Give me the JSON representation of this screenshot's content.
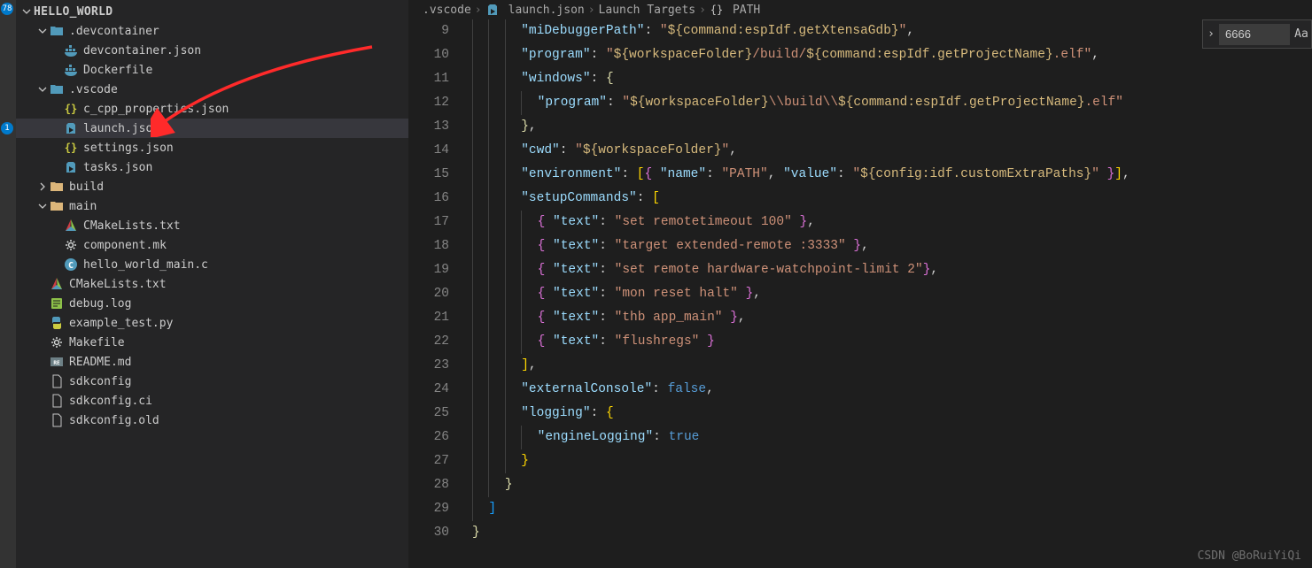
{
  "sidebar": {
    "rootName": "HELLO_WORLD",
    "tree": [
      {
        "indent": 1,
        "chev": "down",
        "icon": "folder-teal",
        "label": ".devcontainer"
      },
      {
        "indent": 2,
        "chev": "",
        "icon": "docker",
        "label": "devcontainer.json"
      },
      {
        "indent": 2,
        "chev": "",
        "icon": "docker",
        "label": "Dockerfile"
      },
      {
        "indent": 1,
        "chev": "down",
        "icon": "folder-teal",
        "label": ".vscode"
      },
      {
        "indent": 2,
        "chev": "",
        "icon": "json",
        "label": "c_cpp_properties.json"
      },
      {
        "indent": 2,
        "chev": "",
        "icon": "debug",
        "label": "launch.json",
        "selected": true
      },
      {
        "indent": 2,
        "chev": "",
        "icon": "json",
        "label": "settings.json"
      },
      {
        "indent": 2,
        "chev": "",
        "icon": "debug",
        "label": "tasks.json"
      },
      {
        "indent": 1,
        "chev": "right",
        "icon": "folder",
        "label": "build"
      },
      {
        "indent": 1,
        "chev": "down",
        "icon": "folder",
        "label": "main"
      },
      {
        "indent": 2,
        "chev": "",
        "icon": "cmake",
        "label": "CMakeLists.txt"
      },
      {
        "indent": 2,
        "chev": "",
        "icon": "gear",
        "label": "component.mk"
      },
      {
        "indent": 2,
        "chev": "",
        "icon": "c",
        "label": "hello_world_main.c"
      },
      {
        "indent": 1,
        "chev": "",
        "icon": "cmake",
        "label": "CMakeLists.txt"
      },
      {
        "indent": 1,
        "chev": "",
        "icon": "log",
        "label": "debug.log"
      },
      {
        "indent": 1,
        "chev": "",
        "icon": "python",
        "label": "example_test.py"
      },
      {
        "indent": 1,
        "chev": "",
        "icon": "gear",
        "label": "Makefile"
      },
      {
        "indent": 1,
        "chev": "",
        "icon": "readme",
        "label": "README.md"
      },
      {
        "indent": 1,
        "chev": "",
        "icon": "file",
        "label": "sdkconfig"
      },
      {
        "indent": 1,
        "chev": "",
        "icon": "file",
        "label": "sdkconfig.ci"
      },
      {
        "indent": 1,
        "chev": "",
        "icon": "file",
        "label": "sdkconfig.old"
      }
    ]
  },
  "breadcrumbs": {
    "parts": [
      {
        "icon": "",
        "text": ".vscode"
      },
      {
        "icon": "debug",
        "text": "launch.json"
      },
      {
        "icon": "",
        "text": "Launch Targets"
      },
      {
        "icon": "braces",
        "text": "PATH"
      }
    ]
  },
  "find": {
    "value": "6666"
  },
  "code": {
    "startLine": 9,
    "lines": [
      {
        "indent": 3,
        "tokens": [
          [
            "key",
            "\"miDebuggerPath\""
          ],
          [
            "punct",
            ": "
          ],
          [
            "str",
            "\""
          ],
          [
            "strvar",
            "${command:espIdf.getXtensaGdb}"
          ],
          [
            "str",
            "\""
          ],
          [
            "punct",
            ","
          ]
        ]
      },
      {
        "indent": 3,
        "tokens": [
          [
            "key",
            "\"program\""
          ],
          [
            "punct",
            ": "
          ],
          [
            "str",
            "\""
          ],
          [
            "strvar",
            "${workspaceFolder}"
          ],
          [
            "str",
            "/build/"
          ],
          [
            "strvar",
            "${command:espIdf.getProjectName}"
          ],
          [
            "str",
            ".elf\""
          ],
          [
            "punct",
            ","
          ]
        ]
      },
      {
        "indent": 3,
        "tokens": [
          [
            "key",
            "\"windows\""
          ],
          [
            "punct",
            ": "
          ],
          [
            "brace",
            "{"
          ]
        ]
      },
      {
        "indent": 4,
        "tokens": [
          [
            "key",
            "\"program\""
          ],
          [
            "punct",
            ": "
          ],
          [
            "str",
            "\""
          ],
          [
            "strvar",
            "${workspaceFolder}"
          ],
          [
            "str",
            "\\\\build\\\\"
          ],
          [
            "strvar",
            "${command:espIdf.getProjectName}"
          ],
          [
            "str",
            ".elf\""
          ]
        ]
      },
      {
        "indent": 3,
        "tokens": [
          [
            "brace",
            "}"
          ],
          [
            "punct",
            ","
          ]
        ]
      },
      {
        "indent": 3,
        "tokens": [
          [
            "key",
            "\"cwd\""
          ],
          [
            "punct",
            ": "
          ],
          [
            "str",
            "\""
          ],
          [
            "strvar",
            "${workspaceFolder}"
          ],
          [
            "str",
            "\""
          ],
          [
            "punct",
            ","
          ]
        ]
      },
      {
        "indent": 3,
        "tokens": [
          [
            "key",
            "\"environment\""
          ],
          [
            "punct",
            ": "
          ],
          [
            "bracket1",
            "["
          ],
          [
            "bracket2",
            "{"
          ],
          [
            "punct",
            " "
          ],
          [
            "key",
            "\"name\""
          ],
          [
            "punct",
            ": "
          ],
          [
            "str",
            "\"PATH\""
          ],
          [
            "punct",
            ", "
          ],
          [
            "key",
            "\"value\""
          ],
          [
            "punct",
            ": "
          ],
          [
            "str",
            "\""
          ],
          [
            "strvar",
            "${config:idf.customExtraPaths}"
          ],
          [
            "str",
            "\""
          ],
          [
            "punct",
            " "
          ],
          [
            "bracket2",
            "}"
          ],
          [
            "bracket1",
            "]"
          ],
          [
            "punct",
            ","
          ]
        ]
      },
      {
        "indent": 3,
        "tokens": [
          [
            "key",
            "\"setupCommands\""
          ],
          [
            "punct",
            ": "
          ],
          [
            "bracket1",
            "["
          ]
        ]
      },
      {
        "indent": 4,
        "tokens": [
          [
            "bracket2",
            "{"
          ],
          [
            "punct",
            " "
          ],
          [
            "key",
            "\"text\""
          ],
          [
            "punct",
            ": "
          ],
          [
            "str",
            "\"set remotetimeout 100\""
          ],
          [
            "punct",
            " "
          ],
          [
            "bracket2",
            "}"
          ],
          [
            "punct",
            ","
          ]
        ]
      },
      {
        "indent": 4,
        "tokens": [
          [
            "bracket2",
            "{"
          ],
          [
            "punct",
            " "
          ],
          [
            "key",
            "\"text\""
          ],
          [
            "punct",
            ": "
          ],
          [
            "str",
            "\"target extended-remote :3333\""
          ],
          [
            "punct",
            " "
          ],
          [
            "bracket2",
            "}"
          ],
          [
            "punct",
            ","
          ]
        ]
      },
      {
        "indent": 4,
        "tokens": [
          [
            "bracket2",
            "{"
          ],
          [
            "punct",
            " "
          ],
          [
            "key",
            "\"text\""
          ],
          [
            "punct",
            ": "
          ],
          [
            "str",
            "\"set remote hardware-watchpoint-limit 2\""
          ],
          [
            "bracket2",
            "}"
          ],
          [
            "punct",
            ","
          ]
        ]
      },
      {
        "indent": 4,
        "tokens": [
          [
            "bracket2",
            "{"
          ],
          [
            "punct",
            " "
          ],
          [
            "key",
            "\"text\""
          ],
          [
            "punct",
            ": "
          ],
          [
            "str",
            "\"mon reset halt\""
          ],
          [
            "punct",
            " "
          ],
          [
            "bracket2",
            "}"
          ],
          [
            "punct",
            ","
          ]
        ]
      },
      {
        "indent": 4,
        "tokens": [
          [
            "bracket2",
            "{"
          ],
          [
            "punct",
            " "
          ],
          [
            "key",
            "\"text\""
          ],
          [
            "punct",
            ": "
          ],
          [
            "str",
            "\"thb app_main\""
          ],
          [
            "punct",
            " "
          ],
          [
            "bracket2",
            "}"
          ],
          [
            "punct",
            ","
          ]
        ]
      },
      {
        "indent": 4,
        "tokens": [
          [
            "bracket2",
            "{"
          ],
          [
            "punct",
            " "
          ],
          [
            "key",
            "\"text\""
          ],
          [
            "punct",
            ": "
          ],
          [
            "str",
            "\"flushregs\""
          ],
          [
            "punct",
            " "
          ],
          [
            "bracket2",
            "}"
          ]
        ]
      },
      {
        "indent": 3,
        "tokens": [
          [
            "bracket1",
            "]"
          ],
          [
            "punct",
            ","
          ]
        ]
      },
      {
        "indent": 3,
        "tokens": [
          [
            "key",
            "\"externalConsole\""
          ],
          [
            "punct",
            ": "
          ],
          [
            "bool",
            "false"
          ],
          [
            "punct",
            ","
          ]
        ]
      },
      {
        "indent": 3,
        "tokens": [
          [
            "key",
            "\"logging\""
          ],
          [
            "punct",
            ": "
          ],
          [
            "bracket1",
            "{"
          ]
        ]
      },
      {
        "indent": 4,
        "tokens": [
          [
            "key",
            "\"engineLogging\""
          ],
          [
            "punct",
            ": "
          ],
          [
            "bool",
            "true"
          ]
        ]
      },
      {
        "indent": 3,
        "tokens": [
          [
            "bracket1",
            "}"
          ]
        ]
      },
      {
        "indent": 2,
        "tokens": [
          [
            "brace",
            "}"
          ]
        ]
      },
      {
        "indent": 1,
        "tokens": [
          [
            "bracket3",
            "]"
          ]
        ]
      },
      {
        "indent": 0,
        "tokens": [
          [
            "brace",
            "}"
          ]
        ]
      }
    ]
  },
  "watermark": "CSDN @BoRuiYiQi"
}
